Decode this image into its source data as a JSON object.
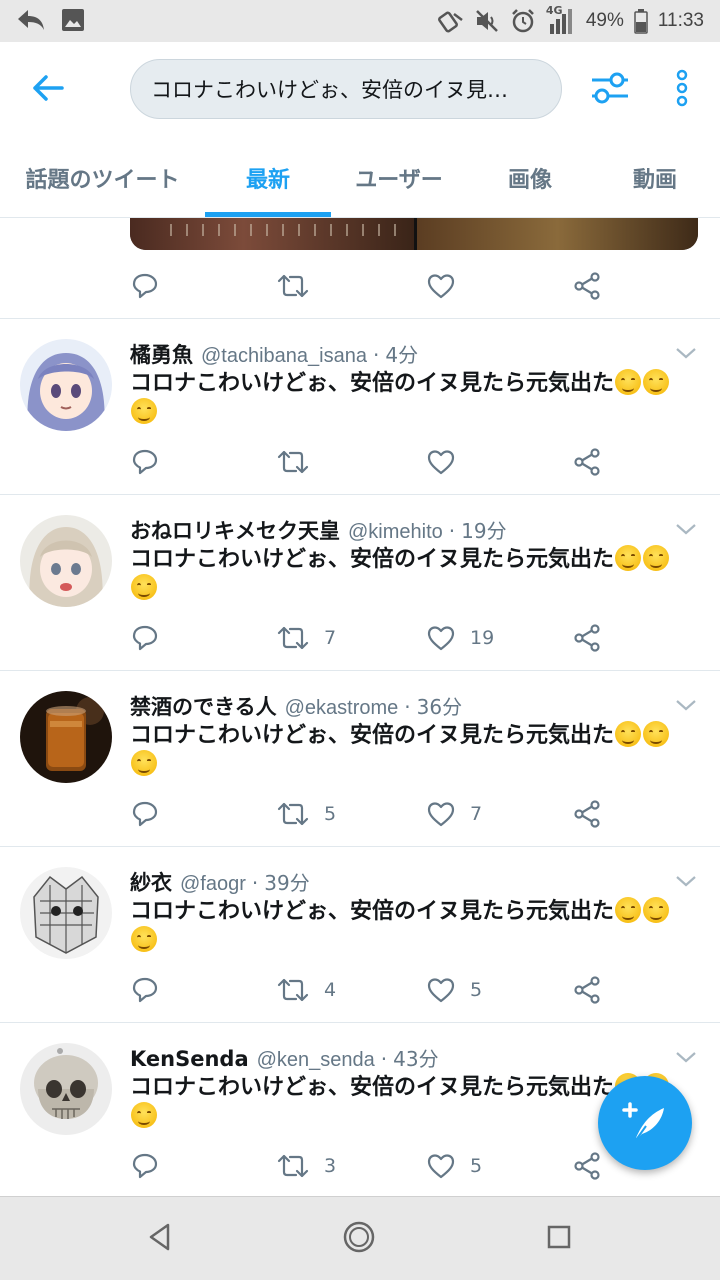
{
  "status_bar": {
    "battery": "49%",
    "time": "11:33",
    "network": "4G"
  },
  "app_bar": {
    "search_query": "コロナこわいけどぉ、安倍のイヌ見…"
  },
  "tabs": [
    {
      "label": "話題のツイート",
      "active": false
    },
    {
      "label": "最新",
      "active": true
    },
    {
      "label": "ユーザー",
      "active": false
    },
    {
      "label": "画像",
      "active": false
    },
    {
      "label": "動画",
      "active": false
    }
  ],
  "top_actions": {
    "retweets": "",
    "likes": ""
  },
  "tweets": [
    {
      "name": "橘勇魚",
      "handle": "@tachibana_isana",
      "time": "4分",
      "text": "コロナこわいけどぉ、安倍のイヌ見たら元気出た",
      "retweets": "",
      "likes": ""
    },
    {
      "name": "おねロリキメセク天皇",
      "handle": "@kimehito",
      "time": "19分",
      "text": "コロナこわいけどぉ、安倍のイヌ見たら元気出た",
      "retweets": "7",
      "likes": "19"
    },
    {
      "name": "禁酒のできる人",
      "handle": "@ekastrome",
      "time": "36分",
      "text": "コロナこわいけどぉ、安倍のイヌ見たら元気出た",
      "retweets": "5",
      "likes": "7"
    },
    {
      "name": "紗衣",
      "handle": "@faogr",
      "time": "39分",
      "text": "コロナこわいけどぉ、安倍のイヌ見たら元気出た",
      "retweets": "4",
      "likes": "5"
    },
    {
      "name": "KenSenda",
      "handle": "@ken_senda",
      "time": "43分",
      "text": "コロナこわいけどぉ、安倍のイヌ見たら元気出た",
      "retweets": "3",
      "likes": "5"
    }
  ],
  "icons": {
    "back": "arrow-left-icon",
    "filter": "sliders-icon",
    "more": "more-vertical-icon",
    "reply": "reply-icon",
    "retweet": "retweet-icon",
    "like": "heart-icon",
    "share": "share-icon",
    "compose": "compose-feather-icon"
  },
  "colors": {
    "accent": "#1da1f2",
    "secondary_text": "#657786",
    "divider": "#e1e8ed"
  }
}
